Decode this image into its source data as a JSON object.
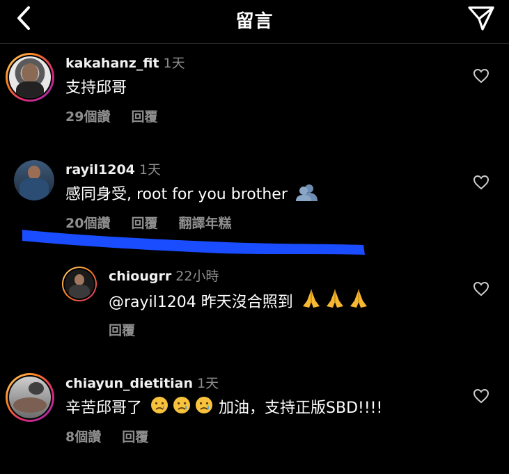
{
  "header": {
    "title": "留言"
  },
  "comments": [
    {
      "username": "kakahanz_fit",
      "time": "1天",
      "text": "支持邱哥",
      "likes": "29個讚",
      "reply": "回覆"
    },
    {
      "username": "rayil1204",
      "time": "1天",
      "text": "感同身受, root for you brother",
      "likes": "20個讚",
      "reply": "回覆",
      "translate": "翻譯年糕"
    },
    {
      "username": "chiougrr",
      "time": "22小時",
      "text": "@rayil1204 昨天沒合照到",
      "reply": "回覆",
      "is_reply": true
    },
    {
      "username": "chiayun_dietitian",
      "time": "1天",
      "text_before": "辛苦邱哥了",
      "text_after": "加油，支持正版SBD!!!!",
      "likes": "8個讚",
      "reply": "回覆"
    }
  ],
  "colors": {
    "accent_annotation": "#1a4dff",
    "secondary_text": "#8e8e8e"
  },
  "icons": [
    "back-chevron-icon",
    "send-icon",
    "heart-icon",
    "busts-emoji-icon",
    "folded-hands-emoji-icon",
    "crying-face-emoji-icon"
  ]
}
